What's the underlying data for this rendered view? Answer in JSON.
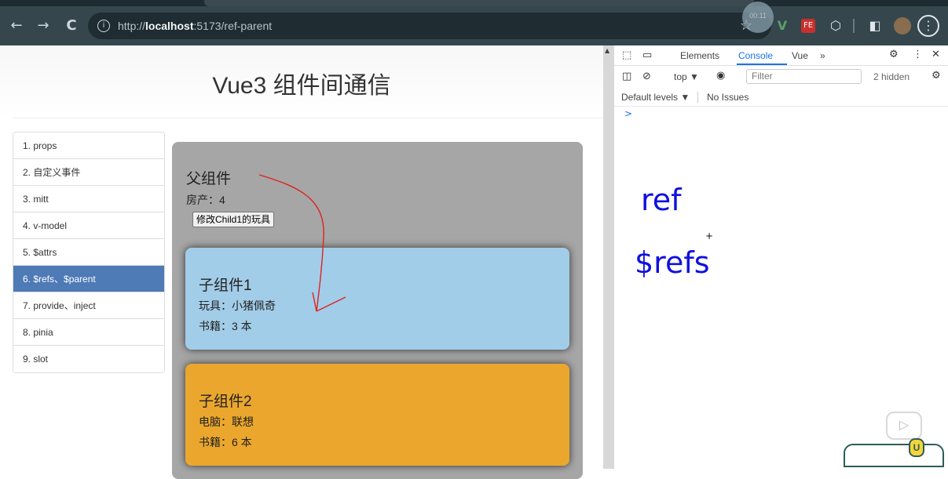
{
  "browser": {
    "url_prefix": "http://",
    "url_host": "localhost",
    "url_rest": ":5173/ref-parent",
    "back_glyph": "←",
    "forward_glyph": "→",
    "reload_glyph": "C",
    "info_glyph": "i",
    "star_glyph": "☆",
    "timer_text": "00:11",
    "ext_vue_text": "V",
    "ext_fe_text": "FE",
    "ext_puzzle_glyph": "⬡",
    "ext_sidepanel_glyph": "◧",
    "ext_menu_glyph": "⋮"
  },
  "app": {
    "title": "Vue3 组件间通信",
    "menu": [
      {
        "label": "1. props"
      },
      {
        "label": "2. 自定义事件"
      },
      {
        "label": "3. mitt"
      },
      {
        "label": "4. v-model"
      },
      {
        "label": "5. $attrs"
      },
      {
        "label": "6. $refs、$parent",
        "active": true
      },
      {
        "label": "7. provide、inject"
      },
      {
        "label": "8. pinia"
      },
      {
        "label": "9. slot"
      }
    ],
    "parent": {
      "title": "父组件",
      "house": "房产：4",
      "button_label": "修改Child1的玩具"
    },
    "child1": {
      "title": "子组件1",
      "toy": "玩具：小猪佩奇",
      "books": "书籍：3 本"
    },
    "child2": {
      "title": "子组件2",
      "computer": "电脑：联想",
      "books": "书籍：6 本"
    }
  },
  "devtools": {
    "tabs": [
      "Elements",
      "Console",
      "Vue",
      "»"
    ],
    "active_tab": "Console",
    "context": "top ▼",
    "filter_placeholder": "Filter",
    "hidden_count": "2 hidden",
    "levels": "Default levels ▼",
    "issues": "No Issues",
    "prompt": ">"
  },
  "annotations": {
    "ref": "ref",
    "refs": "$refs",
    "plus": "+"
  },
  "colors": {
    "menu_active": "#4e7ab6",
    "parent_bg": "#a6a6a6",
    "child1_bg": "#a2cde8",
    "child2_bg": "#eba72d",
    "handwriting": "#1010e0",
    "arrow": "#e02020",
    "devtools_accent": "#1a73e8"
  }
}
